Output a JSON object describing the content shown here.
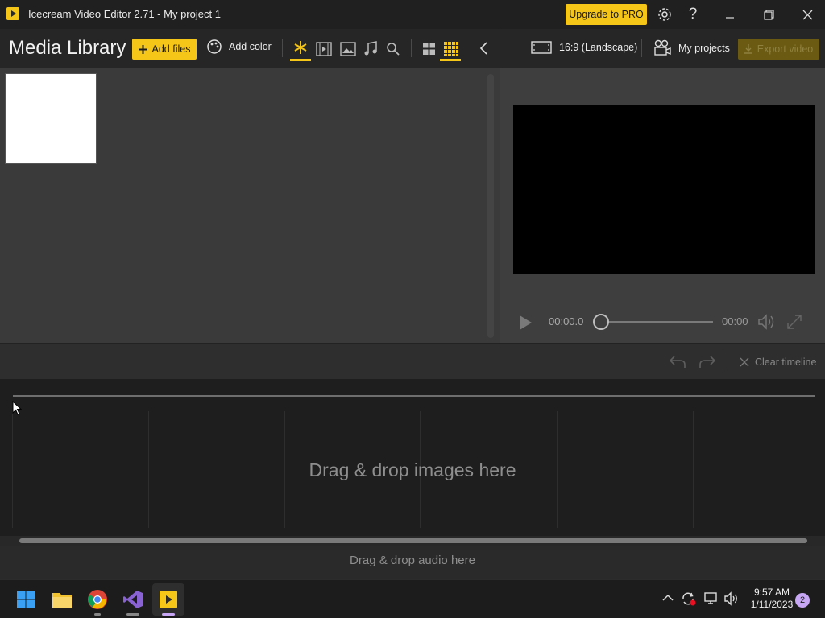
{
  "window": {
    "title": "Icecream Video Editor 2.71  -  My project 1",
    "upgrade_label": "Upgrade to PRO"
  },
  "library": {
    "title": "Media Library",
    "add_files_label": "Add files",
    "add_color_label": "Add color"
  },
  "right_toolbar": {
    "aspect_label": "16:9 (Landscape)",
    "projects_label": "My projects",
    "export_label": "Export video"
  },
  "player": {
    "current_time": "00:00.0",
    "total_time": "00:00",
    "progress": 0
  },
  "timeline": {
    "clear_label": "Clear timeline",
    "drop_images": "Drag & drop images here",
    "drop_audio": "Drag & drop audio here"
  },
  "taskbar": {
    "time": "9:57 AM",
    "date": "1/11/2023",
    "notifications": "2"
  },
  "colors": {
    "accent": "#f5c518",
    "background": "#3a3a3a",
    "timeline_bg": "#1e1e1e"
  }
}
